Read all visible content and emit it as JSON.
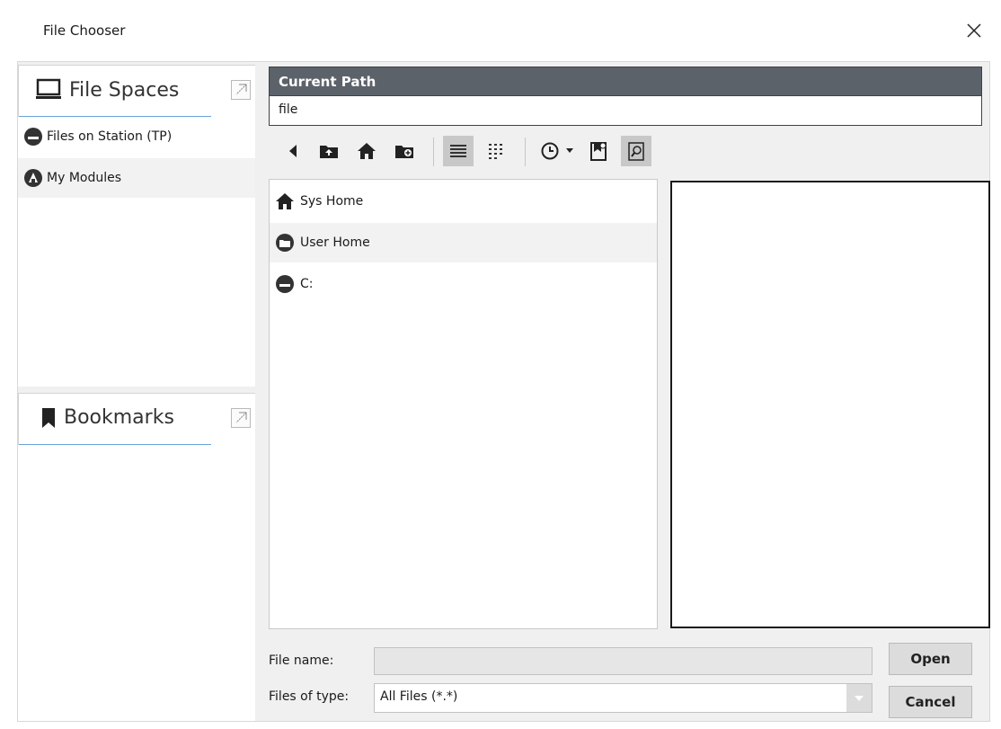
{
  "window": {
    "title": "File Chooser"
  },
  "file_spaces": {
    "label": "File Spaces",
    "items": [
      {
        "label": "Files on Station (TP)",
        "icon": "station-drive-icon"
      },
      {
        "label": "My Modules",
        "icon": "modules-icon"
      }
    ]
  },
  "bookmarks": {
    "label": "Bookmarks"
  },
  "current_path": {
    "header": "Current Path",
    "value": "file"
  },
  "toolbar": {
    "buttons": [
      "back-icon",
      "up-folder-icon",
      "home-icon",
      "new-folder-icon",
      "list-view-icon",
      "details-view-icon",
      "history-icon",
      "history-dropdown-icon",
      "bookmark-add-icon",
      "preview-toggle-icon"
    ]
  },
  "file_list": {
    "rows": [
      {
        "label": "Sys Home",
        "icon": "home-icon"
      },
      {
        "label": "User Home",
        "icon": "user-folder-icon"
      },
      {
        "label": "C:",
        "icon": "drive-icon"
      }
    ]
  },
  "footer": {
    "file_name_label": "File name:",
    "file_name_value": "",
    "files_of_type_label": "Files of type:",
    "files_of_type_value": "All Files (*.*)",
    "open_label": "Open",
    "cancel_label": "Cancel"
  }
}
